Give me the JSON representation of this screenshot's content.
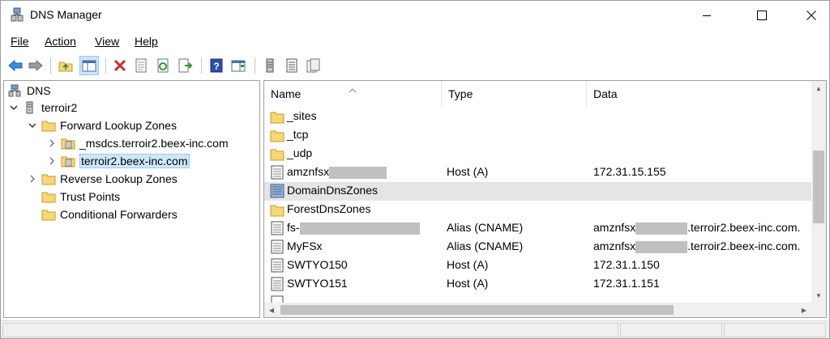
{
  "window": {
    "title": "DNS Manager"
  },
  "menu": [
    {
      "label": "File"
    },
    {
      "label": "Action"
    },
    {
      "label": "View"
    },
    {
      "label": "Help"
    }
  ],
  "tree": {
    "root": "DNS",
    "server": "terroir2",
    "forward": "Forward Lookup Zones",
    "zone1": "_msdcs.terroir2.beex-inc.com",
    "zone2": "terroir2.beex-inc.com",
    "reverse": "Reverse Lookup Zones",
    "trust": "Trust Points",
    "conditional": "Conditional Forwarders"
  },
  "list": {
    "headers": {
      "name": "Name",
      "type": "Type",
      "data": "Data"
    },
    "rows": [
      {
        "name": "_sites",
        "type": "",
        "data": "",
        "icon": "folder-icon"
      },
      {
        "name": "_tcp",
        "type": "",
        "data": "",
        "icon": "folder-icon"
      },
      {
        "name": "_udp",
        "type": "",
        "data": "",
        "icon": "folder-icon"
      },
      {
        "name": "amznfsx",
        "type": "Host (A)",
        "data": "172.31.15.155",
        "icon": "record-icon"
      },
      {
        "name": "DomainDnsZones",
        "type": "",
        "data": "",
        "icon": "zone-folder-icon"
      },
      {
        "name": "ForestDnsZones",
        "type": "",
        "data": "",
        "icon": "folder-icon"
      },
      {
        "name": "fs-",
        "type": "Alias (CNAME)",
        "data": "amznfsx",
        "data_suffix": ".terroir2.beex-inc.com.",
        "icon": "record-icon"
      },
      {
        "name": "MyFSx",
        "type": "Alias (CNAME)",
        "data": "amznfsx",
        "data_suffix": ".terroir2.beex-inc.com.",
        "icon": "record-icon"
      },
      {
        "name": "SWTYO150",
        "type": "Host (A)",
        "data": "172.31.1.150",
        "icon": "record-icon"
      },
      {
        "name": "SWTYO151",
        "type": "Host (A)",
        "data": "172.31.1.151",
        "icon": "record-icon"
      }
    ]
  },
  "colors": {
    "selection": "#cce8ff",
    "row_highlight": "#e5e5e5",
    "folder": "#f8d775"
  }
}
